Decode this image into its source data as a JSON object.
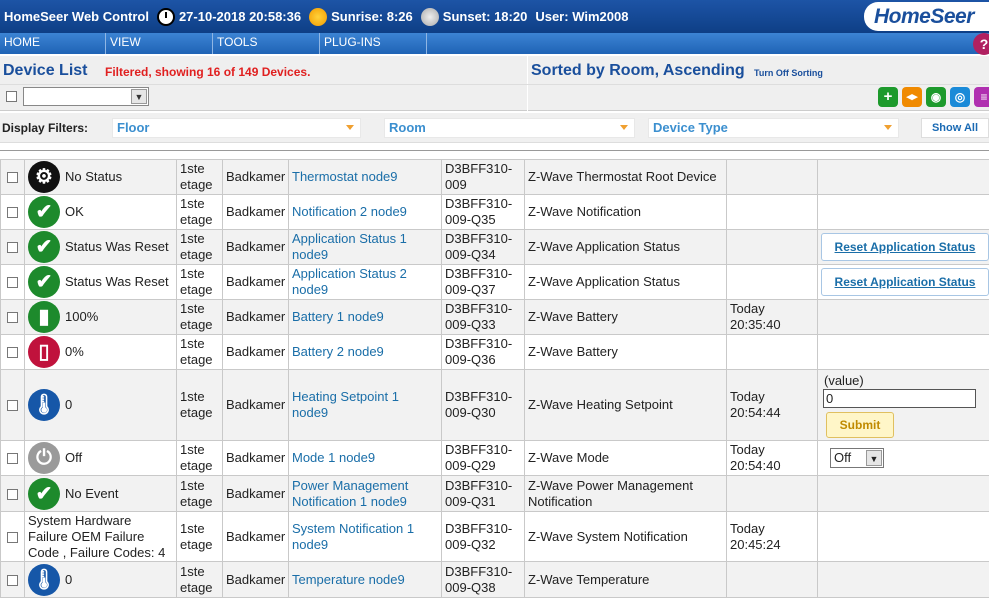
{
  "top": {
    "app_title": "HomeSeer Web Control",
    "datetime": "27-10-2018 20:58:36",
    "sunrise_label": "Sunrise:",
    "sunrise": "8:26",
    "sunset_label": "Sunset:",
    "sunset": "18:20",
    "user_label": "User:",
    "user": "Wim2008",
    "logo": "HomeSeer",
    "help": "?"
  },
  "menu": [
    "HOME",
    "VIEW",
    "TOOLS",
    "PLUG-INS"
  ],
  "header": {
    "title": "Device List",
    "filtered": "Filtered, showing 16 of 149 Devices.",
    "sorted": "Sorted by Room, Ascending",
    "turn_off_sorting": "Turn Off Sorting"
  },
  "filters": {
    "label": "Display Filters:",
    "floor": "Floor",
    "room": "Room",
    "device_type": "Device Type",
    "show_all": "Show All"
  },
  "colors": {
    "brand_blue": "#1a4f9c",
    "link": "#1a6ea8",
    "filter_red": "#e02020",
    "ok_green": "#1d8a2c"
  },
  "rows": [
    {
      "icon": "gear-icon",
      "status": "No Status",
      "floor": "1ste etage",
      "room": "Badkamer",
      "name": "Thermostat node9",
      "address": "D3BFF310-009",
      "type": "Z-Wave Thermostat Root Device",
      "last": "",
      "control": "none"
    },
    {
      "icon": "check-icon",
      "status": "OK",
      "floor": "1ste etage",
      "room": "Badkamer",
      "name": "Notification 2 node9",
      "address": "D3BFF310-009-Q35",
      "type": "Z-Wave Notification",
      "last": "",
      "control": "none"
    },
    {
      "icon": "check-icon",
      "status": "Status Was Reset",
      "floor": "1ste etage",
      "room": "Badkamer",
      "name": "Application Status 1 node9",
      "address": "D3BFF310-009-Q34",
      "type": "Z-Wave Application Status",
      "last": "",
      "control": "reset",
      "control_label": "Reset Application Status"
    },
    {
      "icon": "check-icon",
      "status": "Status Was Reset",
      "floor": "1ste etage",
      "room": "Badkamer",
      "name": "Application Status 2 node9",
      "address": "D3BFF310-009-Q37",
      "type": "Z-Wave Application Status",
      "last": "",
      "control": "reset",
      "control_label": "Reset Application Status"
    },
    {
      "icon": "battery-full-icon",
      "status": "100%",
      "floor": "1ste etage",
      "room": "Badkamer",
      "name": "Battery 1 node9",
      "address": "D3BFF310-009-Q33",
      "type": "Z-Wave Battery",
      "last": "Today 20:35:40",
      "control": "none"
    },
    {
      "icon": "battery-empty-icon",
      "status": "0%",
      "floor": "1ste etage",
      "room": "Badkamer",
      "name": "Battery 2 node9",
      "address": "D3BFF310-009-Q36",
      "type": "Z-Wave Battery",
      "last": "",
      "control": "none"
    },
    {
      "icon": "thermometer-icon",
      "status": "0",
      "floor": "1ste etage",
      "room": "Badkamer",
      "name": "Heating Setpoint 1 node9",
      "address": "D3BFF310-009-Q30",
      "type": "Z-Wave Heating Setpoint",
      "last": "Today 20:54:44",
      "control": "value",
      "value_label": "(value)",
      "value": "0",
      "submit_label": "Submit"
    },
    {
      "icon": "power-icon",
      "status": "Off",
      "floor": "1ste etage",
      "room": "Badkamer",
      "name": "Mode 1 node9",
      "address": "D3BFF310-009-Q29",
      "type": "Z-Wave Mode",
      "last": "Today 20:54:40",
      "control": "select",
      "select_value": "Off"
    },
    {
      "icon": "check-icon",
      "status": "No Event",
      "floor": "1ste etage",
      "room": "Badkamer",
      "name": "Power Management Notification 1 node9",
      "address": "D3BFF310-009-Q31",
      "type": "Z-Wave Power Management Notification",
      "last": "",
      "control": "none"
    },
    {
      "icon": "none",
      "status": "System Hardware Failure OEM Failure Code , Failure Codes: 4",
      "floor": "1ste etage",
      "room": "Badkamer",
      "name": "System Notification 1 node9",
      "address": "D3BFF310-009-Q32",
      "type": "Z-Wave System Notification",
      "last": "Today 20:45:24",
      "control": "none"
    },
    {
      "icon": "thermometer-icon",
      "status": "0",
      "floor": "1ste etage",
      "room": "Badkamer",
      "name": "Temperature node9",
      "address": "D3BFF310-009-Q38",
      "type": "Z-Wave Temperature",
      "last": "",
      "control": "none"
    }
  ]
}
